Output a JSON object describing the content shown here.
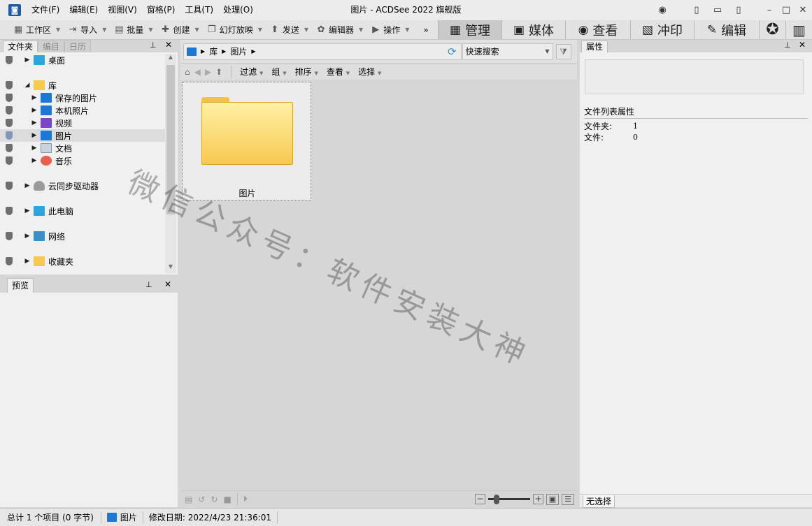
{
  "window": {
    "title": "图片 - ACDSee 2022 旗舰版",
    "menu": [
      "文件(F)",
      "编辑(E)",
      "视图(V)",
      "窗格(P)",
      "工具(T)",
      "处理(O)"
    ]
  },
  "toolbar": {
    "items": [
      {
        "label": "工作区",
        "icon": "workspace-icon"
      },
      {
        "label": "导入",
        "icon": "import-icon"
      },
      {
        "label": "批量",
        "icon": "batch-icon"
      },
      {
        "label": "创建",
        "icon": "create-icon"
      },
      {
        "label": "幻灯放映",
        "icon": "slideshow-icon"
      },
      {
        "label": "发送",
        "icon": "send-icon"
      },
      {
        "label": "编辑器",
        "icon": "editor-icon"
      },
      {
        "label": "操作",
        "icon": "actions-icon"
      }
    ],
    "more": "»",
    "modes": [
      {
        "label": "管理",
        "icon": "grid-icon",
        "active": true
      },
      {
        "label": "媒体",
        "icon": "media-icon",
        "active": false
      },
      {
        "label": "查看",
        "icon": "eye-icon",
        "active": false
      },
      {
        "label": "冲印",
        "icon": "develop-icon",
        "active": false
      },
      {
        "label": "编辑",
        "icon": "edit-icon",
        "active": false
      }
    ]
  },
  "folders": {
    "tabs": [
      "文件夹",
      "编目",
      "日历"
    ],
    "items": [
      {
        "label": "桌面",
        "indent": 0,
        "icon": "desktop-icon"
      },
      {
        "label": "库",
        "indent": 0,
        "icon": "library-folder-icon",
        "expanded": true
      },
      {
        "label": "保存的图片",
        "indent": 1,
        "icon": "picture-icon"
      },
      {
        "label": "本机照片",
        "indent": 1,
        "icon": "picture-icon"
      },
      {
        "label": "视频",
        "indent": 1,
        "icon": "video-icon"
      },
      {
        "label": "图片",
        "indent": 1,
        "icon": "picture-icon",
        "selected": true
      },
      {
        "label": "文档",
        "indent": 1,
        "icon": "document-icon"
      },
      {
        "label": "音乐",
        "indent": 1,
        "icon": "music-icon"
      },
      {
        "label": "云同步驱动器",
        "indent": 0,
        "icon": "cloud-icon"
      },
      {
        "label": "此电脑",
        "indent": 0,
        "icon": "computer-icon"
      },
      {
        "label": "网络",
        "indent": 0,
        "icon": "network-icon"
      },
      {
        "label": "收藏夹",
        "indent": 0,
        "icon": "favorites-folder-icon"
      }
    ]
  },
  "preview": {
    "tab": "预览"
  },
  "center": {
    "breadcrumb": [
      "库",
      "图片"
    ],
    "search_placeholder": "快速搜索",
    "filters": [
      "过滤",
      "组",
      "排序",
      "查看",
      "选择"
    ],
    "files": [
      {
        "name": "图片"
      }
    ]
  },
  "properties": {
    "tab": "属性",
    "section": "文件列表属性",
    "rows": [
      {
        "key": "文件夹:",
        "value": "1"
      },
      {
        "key": "文件:",
        "value": "0"
      }
    ],
    "footer_tab": "无选择"
  },
  "status": {
    "summary": "总计 1 个项目 (0 字节)",
    "location": "图片",
    "modified": "修改日期: 2022/4/23 21:36:01"
  },
  "watermark": "微信公众号：软件安装大神",
  "colors": {
    "accent": "#1d5aa8",
    "folder": "#f6c94f",
    "selected_row": "#dcdcdc"
  }
}
